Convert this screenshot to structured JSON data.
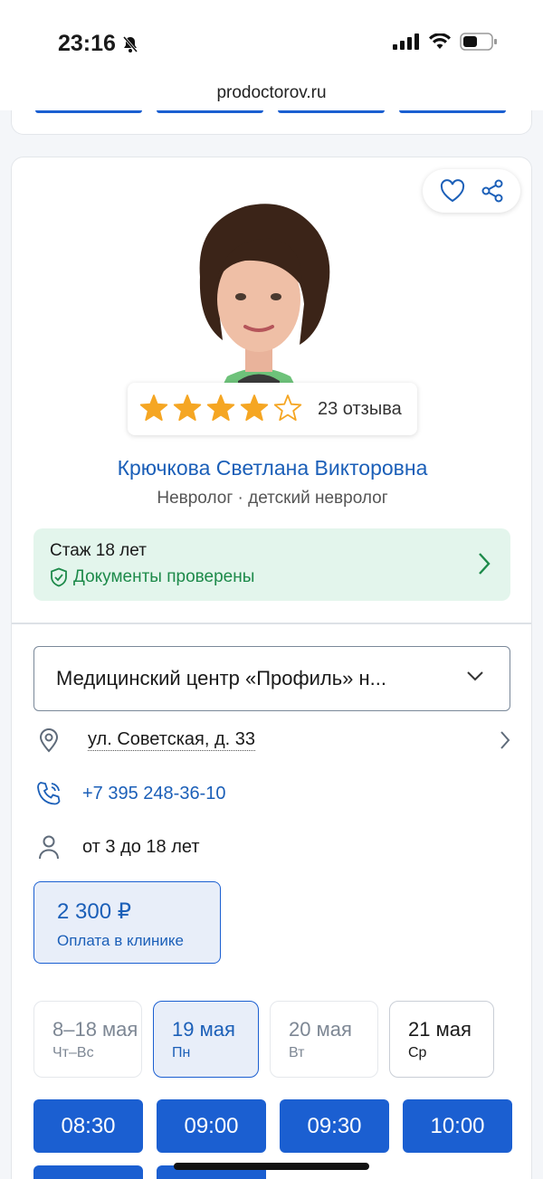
{
  "status_bar": {
    "time": "23:16"
  },
  "browser": {
    "url": "prodoctorov.ru"
  },
  "doctor": {
    "rating": {
      "stars": 4,
      "max_stars": 5,
      "reviews": "23 отзыва"
    },
    "name": "Крючкова Светлана Викторовна",
    "specialty": "Невролог · детский невролог",
    "experience": "Стаж 18 лет",
    "documents": "Документы проверены"
  },
  "clinic": {
    "name": "Медицинский центр «Профиль» н...",
    "address": "ул. Советская, д. 33",
    "phone": "+7 395 248-36-10",
    "age_range": "от 3 до 18 лет"
  },
  "price": {
    "amount": "2 300 ₽",
    "payment": "Оплата в клинике"
  },
  "dates": [
    {
      "date": "8–18 мая",
      "weekday": "Чт–Вс",
      "state": "unavailable"
    },
    {
      "date": "19 мая",
      "weekday": "Пн",
      "state": "selected"
    },
    {
      "date": "20 мая",
      "weekday": "Вт",
      "state": "unavailable"
    },
    {
      "date": "21 мая",
      "weekday": "Ср",
      "state": "available"
    }
  ],
  "slots": [
    "08:30",
    "09:00",
    "09:30",
    "10:00"
  ],
  "colors": {
    "accent": "#1b5fd1",
    "link": "#1b5fb8",
    "success": "#1d8a4a",
    "star": "#f5a623"
  }
}
